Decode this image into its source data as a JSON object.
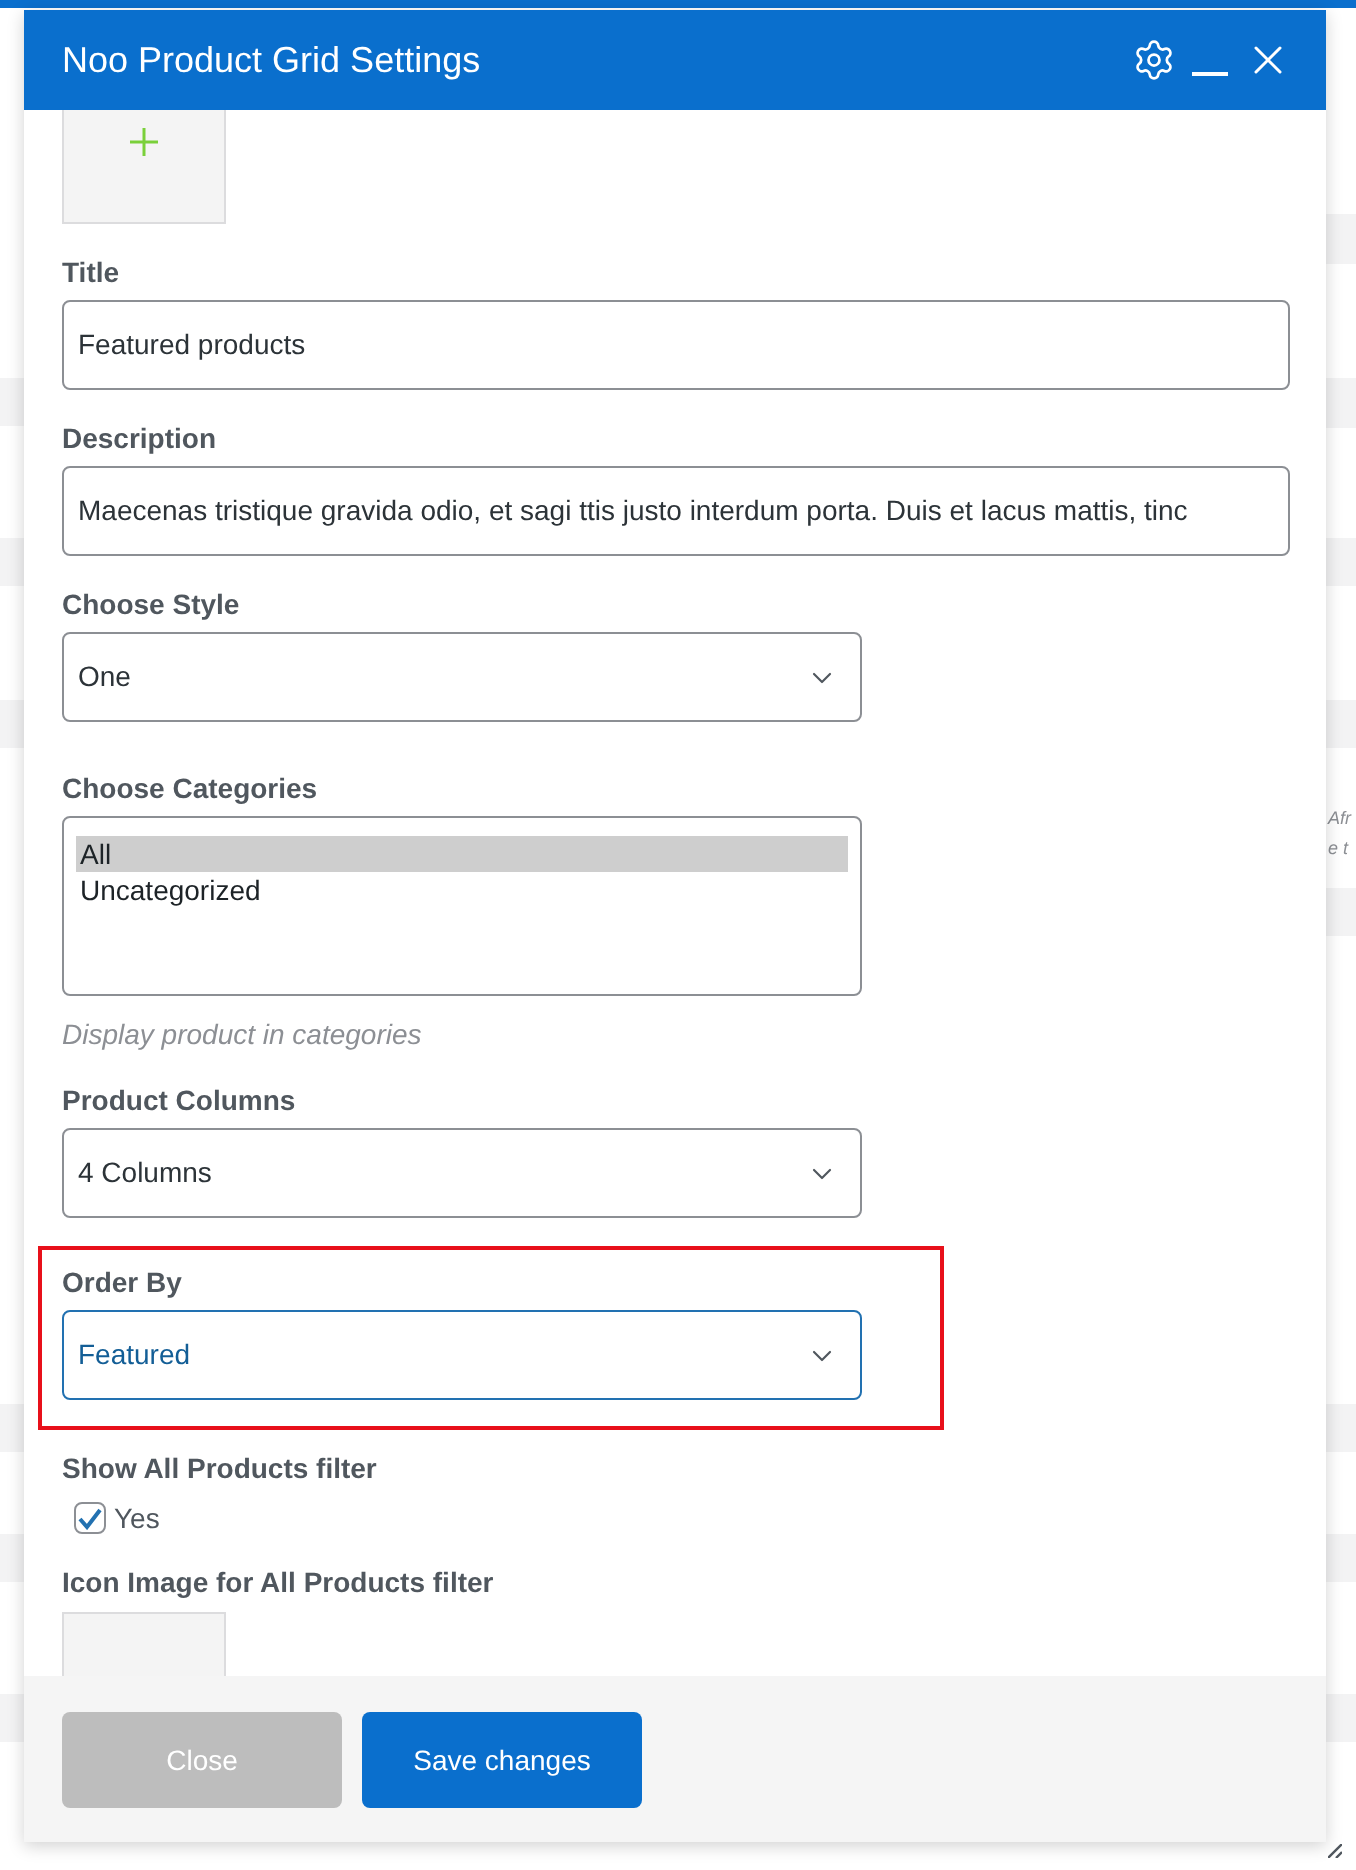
{
  "dialog": {
    "title": "Noo Product Grid Settings"
  },
  "fields": [
    {
      "kind": "image"
    },
    {
      "kind": "text",
      "label": "Title",
      "value": "Featured products"
    },
    {
      "kind": "text",
      "label": "Description",
      "value": "Maecenas tristique gravida odio, et sagi ttis justo interdum porta. Duis et lacus mattis, tinc"
    },
    {
      "kind": "select",
      "label": "Choose Style",
      "value": "One",
      "focused": false
    },
    {
      "kind": "multiselect",
      "label": "Choose Categories",
      "options": [
        {
          "label": "All",
          "selected": true
        },
        {
          "label": "Uncategorized",
          "selected": false
        }
      ],
      "help": "Display product in categories"
    },
    {
      "kind": "select",
      "label": "Product Columns",
      "value": "4 Columns",
      "focused": false
    },
    {
      "kind": "select",
      "label": "Order By",
      "value": "Featured",
      "focused": true,
      "highlighted": true
    },
    {
      "kind": "checkbox",
      "label": "Show All Products filter",
      "option": "Yes",
      "checked": true
    },
    {
      "kind": "image",
      "label": "Icon Image for All Products filter"
    }
  ],
  "buttons": [
    {
      "label": "Close",
      "kind": "secondary"
    },
    {
      "label": "Save changes",
      "kind": "primary"
    }
  ],
  "background": {
    "texts": [
      "Afr",
      "e t"
    ]
  }
}
